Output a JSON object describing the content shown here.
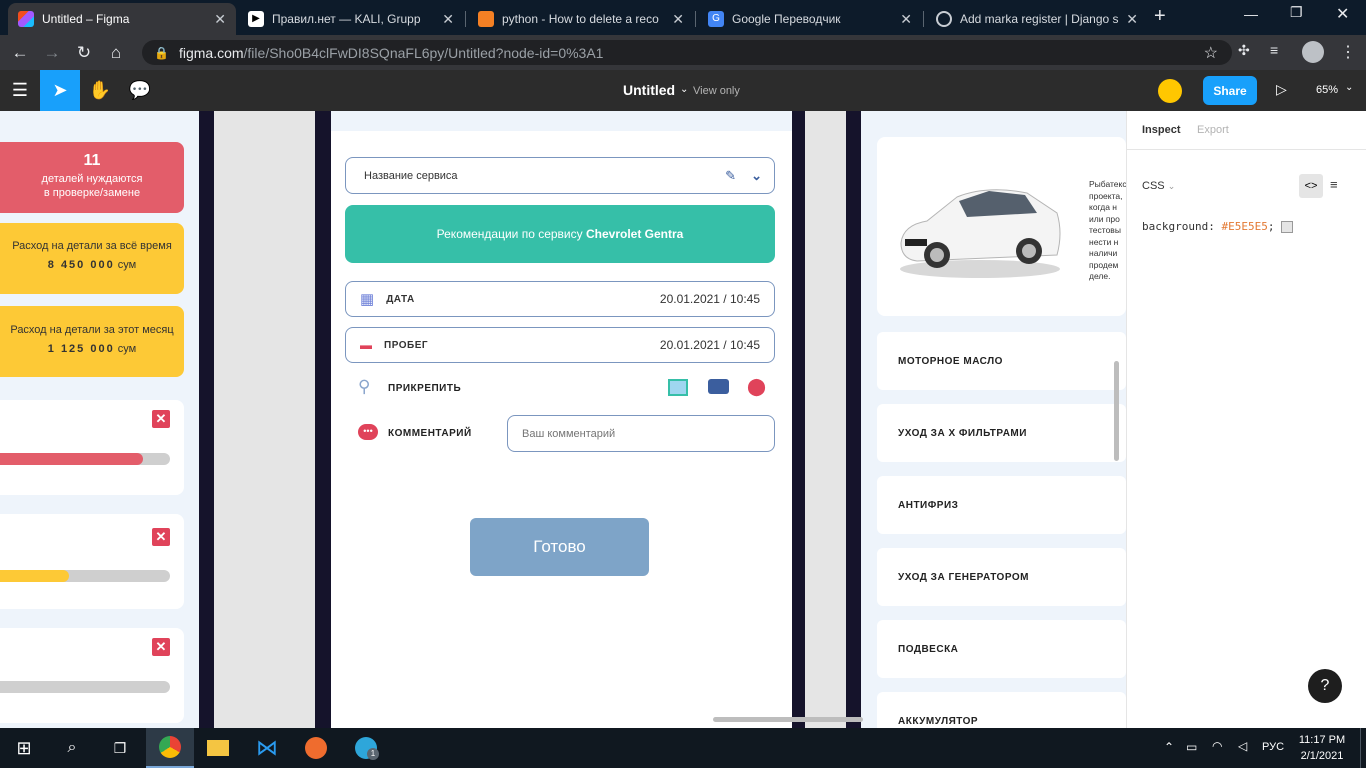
{
  "browser": {
    "tabs": [
      {
        "title": "Untitled – Figma",
        "active": true,
        "icon": "figma-icon",
        "color": "#f24e1e"
      },
      {
        "title": "Правил.нет — KALI, Grupp",
        "active": false,
        "icon": "play-icon",
        "color": "#ffffff"
      },
      {
        "title": "python - How to delete a reco",
        "active": false,
        "icon": "stackoverflow-icon",
        "color": "#f48024"
      },
      {
        "title": "Google Переводчик",
        "active": false,
        "icon": "translate-icon",
        "color": "#4285f4"
      },
      {
        "title": "Add marka register | Django s",
        "active": false,
        "icon": "globe-icon",
        "color": "#c8cdd3"
      }
    ],
    "url_host": "figma.com",
    "url_path": "/file/Sho0B4clFwDI8SQnaFL6py/Untitled?node-id=0%3A1"
  },
  "figma": {
    "file_title": "Untitled",
    "view_mode": "View only",
    "share_label": "Share",
    "zoom": "65%",
    "accent": "#18a0fb"
  },
  "left_frame": {
    "stat1": {
      "count": "11",
      "line1": "деталей нуждаются",
      "line2": "в проверке/замене",
      "color": "#e35d6a"
    },
    "stat2": {
      "line1": "Расход на детали  за всё время",
      "amount": "8 450 000",
      "unit": "сум",
      "color": "#fdc936"
    },
    "stat3": {
      "line1": "Расход на детали за этот месяц",
      "amount": "1 125 000",
      "unit": "сум",
      "color": "#fdc936"
    },
    "progress": [
      {
        "fill": 0.85,
        "color": "#e35d6a"
      },
      {
        "fill": 0.43,
        "color": "#fdc936"
      },
      {
        "fill": 0.0,
        "color": "#cfcfcf"
      }
    ]
  },
  "form": {
    "service_name": "Название сервиса",
    "recommendation_prefix": "Рекомендации по сервису ",
    "recommendation_car": "Chevrolet Gentra",
    "recommendation_color": "#36bfa8",
    "date_label": "ДАТА",
    "date_value": "20.01.2021 / 10:45",
    "mileage_label": "ПРОБЕГ",
    "mileage_value": "20.01.2021 / 10:45",
    "attach_label": "ПРИКРЕПИТЬ",
    "comment_label": "КОММЕНТАРИЙ",
    "comment_placeholder": "Ваш комментарий",
    "done_label": "Готово",
    "done_color": "#7ea4c8"
  },
  "right_frame": {
    "description_lines": [
      "Рыбатекст",
      "проекта,",
      "когда н",
      "или про",
      "тестовы",
      "нести н",
      "наличи",
      "продем",
      "деле."
    ],
    "menu": [
      "МОТОРНОЕ МАСЛО",
      "УХОД ЗА Х ФИЛЬТРАМИ",
      "АНТИФРИЗ",
      "УХОД ЗА ГЕНЕРАТОРОМ",
      "ПОДВЕСКА",
      "АККУМУЛЯТОР"
    ]
  },
  "inspect": {
    "tab_inspect": "Inspect",
    "tab_export": "Export",
    "lang": "CSS",
    "code_prop": "background:",
    "code_value": "#E5E5E5",
    "code_end": ";",
    "help": "?"
  },
  "taskbar": {
    "lang": "РУС",
    "time": "11:17 PM",
    "date": "2/1/2021",
    "telegram_badge": "1"
  }
}
